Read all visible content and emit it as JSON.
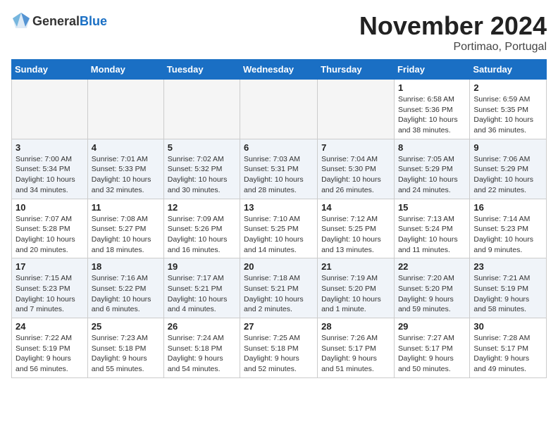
{
  "header": {
    "logo_general": "General",
    "logo_blue": "Blue",
    "month_title": "November 2024",
    "location": "Portimao, Portugal"
  },
  "days_of_week": [
    "Sunday",
    "Monday",
    "Tuesday",
    "Wednesday",
    "Thursday",
    "Friday",
    "Saturday"
  ],
  "weeks": [
    [
      {
        "day": "",
        "detail": ""
      },
      {
        "day": "",
        "detail": ""
      },
      {
        "day": "",
        "detail": ""
      },
      {
        "day": "",
        "detail": ""
      },
      {
        "day": "",
        "detail": ""
      },
      {
        "day": "1",
        "detail": "Sunrise: 6:58 AM\nSunset: 5:36 PM\nDaylight: 10 hours\nand 38 minutes."
      },
      {
        "day": "2",
        "detail": "Sunrise: 6:59 AM\nSunset: 5:35 PM\nDaylight: 10 hours\nand 36 minutes."
      }
    ],
    [
      {
        "day": "3",
        "detail": "Sunrise: 7:00 AM\nSunset: 5:34 PM\nDaylight: 10 hours\nand 34 minutes."
      },
      {
        "day": "4",
        "detail": "Sunrise: 7:01 AM\nSunset: 5:33 PM\nDaylight: 10 hours\nand 32 minutes."
      },
      {
        "day": "5",
        "detail": "Sunrise: 7:02 AM\nSunset: 5:32 PM\nDaylight: 10 hours\nand 30 minutes."
      },
      {
        "day": "6",
        "detail": "Sunrise: 7:03 AM\nSunset: 5:31 PM\nDaylight: 10 hours\nand 28 minutes."
      },
      {
        "day": "7",
        "detail": "Sunrise: 7:04 AM\nSunset: 5:30 PM\nDaylight: 10 hours\nand 26 minutes."
      },
      {
        "day": "8",
        "detail": "Sunrise: 7:05 AM\nSunset: 5:29 PM\nDaylight: 10 hours\nand 24 minutes."
      },
      {
        "day": "9",
        "detail": "Sunrise: 7:06 AM\nSunset: 5:29 PM\nDaylight: 10 hours\nand 22 minutes."
      }
    ],
    [
      {
        "day": "10",
        "detail": "Sunrise: 7:07 AM\nSunset: 5:28 PM\nDaylight: 10 hours\nand 20 minutes."
      },
      {
        "day": "11",
        "detail": "Sunrise: 7:08 AM\nSunset: 5:27 PM\nDaylight: 10 hours\nand 18 minutes."
      },
      {
        "day": "12",
        "detail": "Sunrise: 7:09 AM\nSunset: 5:26 PM\nDaylight: 10 hours\nand 16 minutes."
      },
      {
        "day": "13",
        "detail": "Sunrise: 7:10 AM\nSunset: 5:25 PM\nDaylight: 10 hours\nand 14 minutes."
      },
      {
        "day": "14",
        "detail": "Sunrise: 7:12 AM\nSunset: 5:25 PM\nDaylight: 10 hours\nand 13 minutes."
      },
      {
        "day": "15",
        "detail": "Sunrise: 7:13 AM\nSunset: 5:24 PM\nDaylight: 10 hours\nand 11 minutes."
      },
      {
        "day": "16",
        "detail": "Sunrise: 7:14 AM\nSunset: 5:23 PM\nDaylight: 10 hours\nand 9 minutes."
      }
    ],
    [
      {
        "day": "17",
        "detail": "Sunrise: 7:15 AM\nSunset: 5:23 PM\nDaylight: 10 hours\nand 7 minutes."
      },
      {
        "day": "18",
        "detail": "Sunrise: 7:16 AM\nSunset: 5:22 PM\nDaylight: 10 hours\nand 6 minutes."
      },
      {
        "day": "19",
        "detail": "Sunrise: 7:17 AM\nSunset: 5:21 PM\nDaylight: 10 hours\nand 4 minutes."
      },
      {
        "day": "20",
        "detail": "Sunrise: 7:18 AM\nSunset: 5:21 PM\nDaylight: 10 hours\nand 2 minutes."
      },
      {
        "day": "21",
        "detail": "Sunrise: 7:19 AM\nSunset: 5:20 PM\nDaylight: 10 hours\nand 1 minute."
      },
      {
        "day": "22",
        "detail": "Sunrise: 7:20 AM\nSunset: 5:20 PM\nDaylight: 9 hours\nand 59 minutes."
      },
      {
        "day": "23",
        "detail": "Sunrise: 7:21 AM\nSunset: 5:19 PM\nDaylight: 9 hours\nand 58 minutes."
      }
    ],
    [
      {
        "day": "24",
        "detail": "Sunrise: 7:22 AM\nSunset: 5:19 PM\nDaylight: 9 hours\nand 56 minutes."
      },
      {
        "day": "25",
        "detail": "Sunrise: 7:23 AM\nSunset: 5:18 PM\nDaylight: 9 hours\nand 55 minutes."
      },
      {
        "day": "26",
        "detail": "Sunrise: 7:24 AM\nSunset: 5:18 PM\nDaylight: 9 hours\nand 54 minutes."
      },
      {
        "day": "27",
        "detail": "Sunrise: 7:25 AM\nSunset: 5:18 PM\nDaylight: 9 hours\nand 52 minutes."
      },
      {
        "day": "28",
        "detail": "Sunrise: 7:26 AM\nSunset: 5:17 PM\nDaylight: 9 hours\nand 51 minutes."
      },
      {
        "day": "29",
        "detail": "Sunrise: 7:27 AM\nSunset: 5:17 PM\nDaylight: 9 hours\nand 50 minutes."
      },
      {
        "day": "30",
        "detail": "Sunrise: 7:28 AM\nSunset: 5:17 PM\nDaylight: 9 hours\nand 49 minutes."
      }
    ]
  ]
}
